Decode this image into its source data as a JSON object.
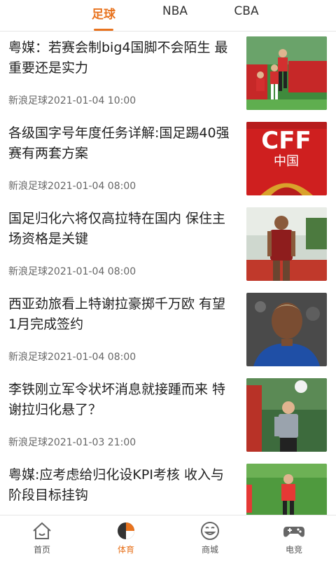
{
  "top_tabs": [
    {
      "label": "足球",
      "active": true
    },
    {
      "label": "NBA",
      "active": false
    },
    {
      "label": "CBA",
      "active": false
    }
  ],
  "news": [
    {
      "title": "粤媒：若赛会制big4国脚不会陌生 最重要还是实力",
      "source_time": "新浪足球2021-01-04 10:00"
    },
    {
      "title": "各级国字号年度任务详解:国足踢40强赛有两套方案",
      "source_time": "新浪足球2021-01-04 08:00"
    },
    {
      "title": "国足归化六将仅高拉特在国内 保住主场资格是关键",
      "source_time": "新浪足球2021-01-04 08:00"
    },
    {
      "title": "西亚劲旅看上特谢拉豪掷千万欧 有望1月完成签约",
      "source_time": "新浪足球2021-01-04 08:00"
    },
    {
      "title": "李铁刚立军令状坏消息就接踵而来 特谢拉归化悬了？",
      "source_time": "新浪足球2021-01-03 21:00"
    },
    {
      "title": "粤媒:应考虑给归化设KPI考核 收入与阶段目标挂钩",
      "source_time": ""
    }
  ],
  "thumb_text": {
    "cff": "CFF",
    "china": "中国"
  },
  "bottom_nav": [
    {
      "label": "首页",
      "icon": "home-icon",
      "active": false
    },
    {
      "label": "体育",
      "icon": "sports-pie-icon",
      "active": true
    },
    {
      "label": "商城",
      "icon": "mall-face-icon",
      "active": false
    },
    {
      "label": "电竞",
      "icon": "gamepad-icon",
      "active": false
    }
  ],
  "colors": {
    "accent": "#e8731e",
    "text": "#222222",
    "meta": "#666666"
  }
}
